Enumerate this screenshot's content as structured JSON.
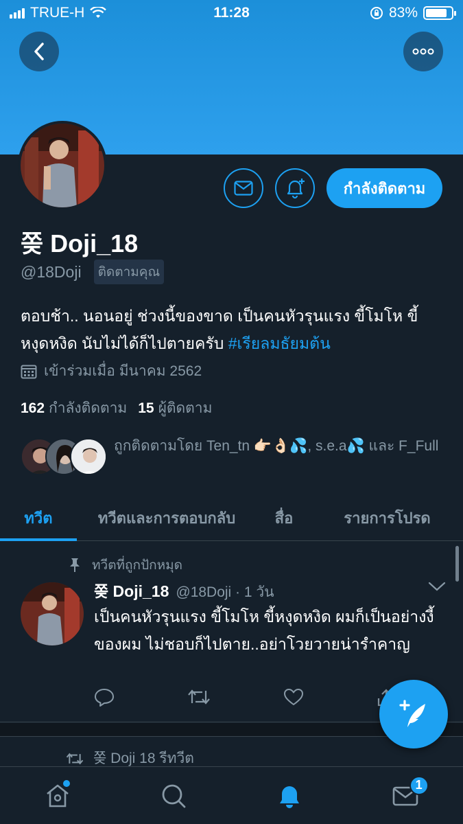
{
  "status_bar": {
    "carrier": "TRUE-H",
    "time": "11:28",
    "battery_percent": "83%",
    "battery_level": 0.83
  },
  "profile": {
    "display_name": "쫒 Doji_18",
    "handle": "@18Doji",
    "follows_you_badge": "ติดตามคุณ",
    "bio_text": "ตอบช้า.. นอนอยู่ ช่วงนี้ของขาด เป็นคนหัวรุนแรง ขี้โมโห ขี้หงุดหงิด นับไม่ได้ก็ไปตายครับ ",
    "bio_hashtag": "#เรียลมธัยมต้น",
    "joined": "เข้าร่วมเมื่อ มีนาคม 2562",
    "following_count": "162",
    "following_label": "กำลังติดตาม",
    "followers_count": "15",
    "followers_label": "ผู้ติดตาม",
    "followed_by_text": "ถูกติดตามโดย Ten_tn 👉🏻👌🏻💦, s.e.a💦 และ F_Full",
    "follow_button_label": "กำลังติดตาม"
  },
  "tabs": [
    {
      "label": "ทวีต",
      "active": true
    },
    {
      "label": "ทวีตและการตอบกลับ",
      "active": false
    },
    {
      "label": "สื่อ",
      "active": false
    },
    {
      "label": "รายการโปรด",
      "active": false
    }
  ],
  "pinned_tweet": {
    "pinned_label": "ทวีตที่ถูกปักหมุด",
    "author_name": "쫒 Doji_18",
    "author_meta": "@18Doji · 1 วัน",
    "text": "เป็นคนหัวรุนแรง ขี้โมโห ขี้หงุดหงิด ผมก็เป็นอย่างงี้ของผม ไม่ชอบก็ไปตาย..อย่าโวยวายน่ารำคาญ"
  },
  "next_tweet": {
    "retweet_label": "쫒 Doji 18 รีทวีต"
  },
  "bottom_nav": {
    "messages_badge": "1"
  },
  "colors": {
    "background": "#15202b",
    "accent": "#1da1f2",
    "secondary_text": "#8899a6",
    "divider": "#38444d"
  }
}
